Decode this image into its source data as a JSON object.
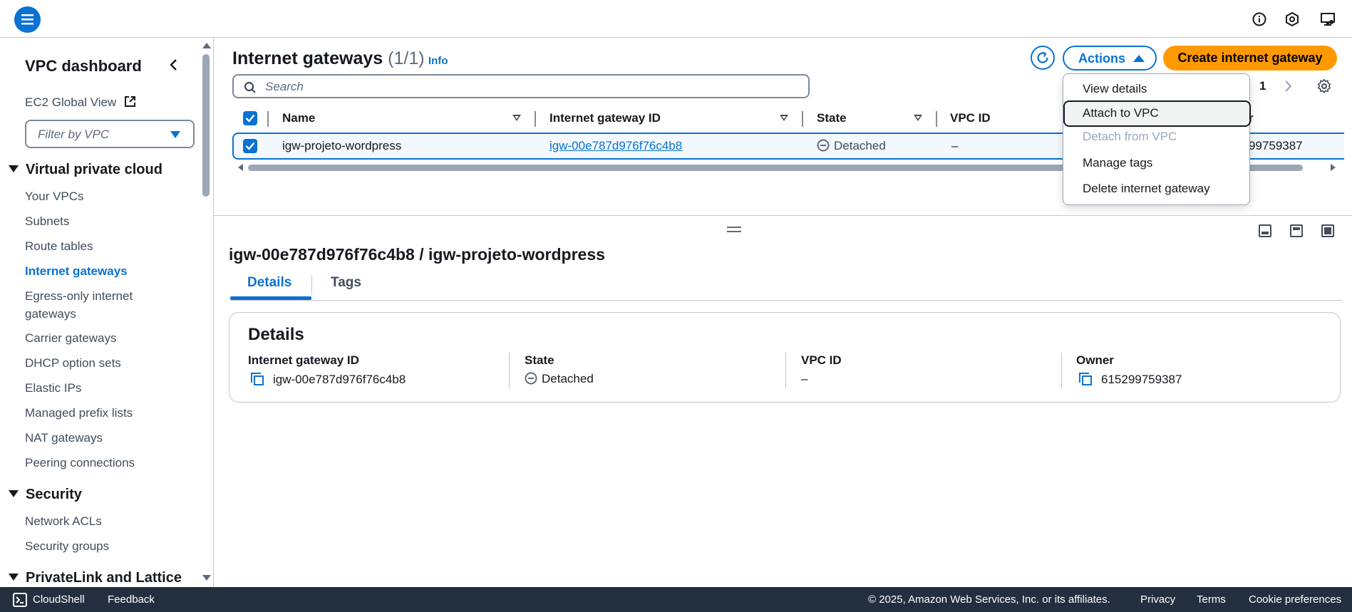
{
  "colors": {
    "accent": "#0972d3",
    "primary_button": "#ff9900",
    "footer_bg": "#232f3e",
    "border": "#c6c6cd"
  },
  "topbar": {
    "icons": [
      "menu-icon",
      "info-icon",
      "notifications-icon",
      "display-settings-icon"
    ]
  },
  "sidebar": {
    "title": "VPC dashboard",
    "global_view_label": "EC2 Global View",
    "filter_placeholder": "Filter by VPC",
    "sections": [
      {
        "label": "Virtual private cloud",
        "items": [
          "Your VPCs",
          "Subnets",
          "Route tables",
          "Internet gateways",
          "Egress-only internet gateways",
          "Carrier gateways",
          "DHCP option sets",
          "Elastic IPs",
          "Managed prefix lists",
          "NAT gateways",
          "Peering connections"
        ]
      },
      {
        "label": "Security",
        "items": [
          "Network ACLs",
          "Security groups"
        ]
      },
      {
        "label": "PrivateLink and Lattice",
        "items": []
      }
    ],
    "active_item": "Internet gateways"
  },
  "table": {
    "title": "Internet gateways",
    "count": "(1/1)",
    "info_link": "Info",
    "search_placeholder": "Search",
    "page_number": "1",
    "actions_label": "Actions",
    "create_label": "Create internet gateway",
    "columns": [
      "Name",
      "Internet gateway ID",
      "State",
      "VPC ID",
      "Owner"
    ],
    "owner_header_fragment": "r",
    "rows": [
      {
        "name": "igw-projeto-wordpress",
        "id": "igw-00e787d976f76c4b8",
        "state": "Detached",
        "vpc_id": "–",
        "owner_fragment": "99759387"
      }
    ]
  },
  "actions_menu": {
    "items": [
      {
        "label": "View details",
        "disabled": false
      },
      {
        "label": "Attach to VPC",
        "disabled": false
      },
      {
        "label": "Detach from VPC",
        "disabled": true
      },
      {
        "label": "Manage tags",
        "disabled": false
      },
      {
        "label": "Delete internet gateway",
        "disabled": false
      }
    ]
  },
  "split_panel": {
    "title": "igw-00e787d976f76c4b8 / igw-projeto-wordpress",
    "tabs": [
      "Details",
      "Tags"
    ],
    "active_tab": "Details",
    "details": {
      "heading": "Details",
      "fields": [
        {
          "label": "Internet gateway ID",
          "value": "igw-00e787d976f76c4b8"
        },
        {
          "label": "State",
          "value": "Detached"
        },
        {
          "label": "VPC ID",
          "value": "–"
        },
        {
          "label": "Owner",
          "value": "615299759387"
        }
      ]
    }
  },
  "footer": {
    "cloudshell": "CloudShell",
    "feedback": "Feedback",
    "copyright": "© 2025, Amazon Web Services, Inc. or its affiliates.",
    "privacy": "Privacy",
    "terms": "Terms",
    "cookies": "Cookie preferences"
  }
}
